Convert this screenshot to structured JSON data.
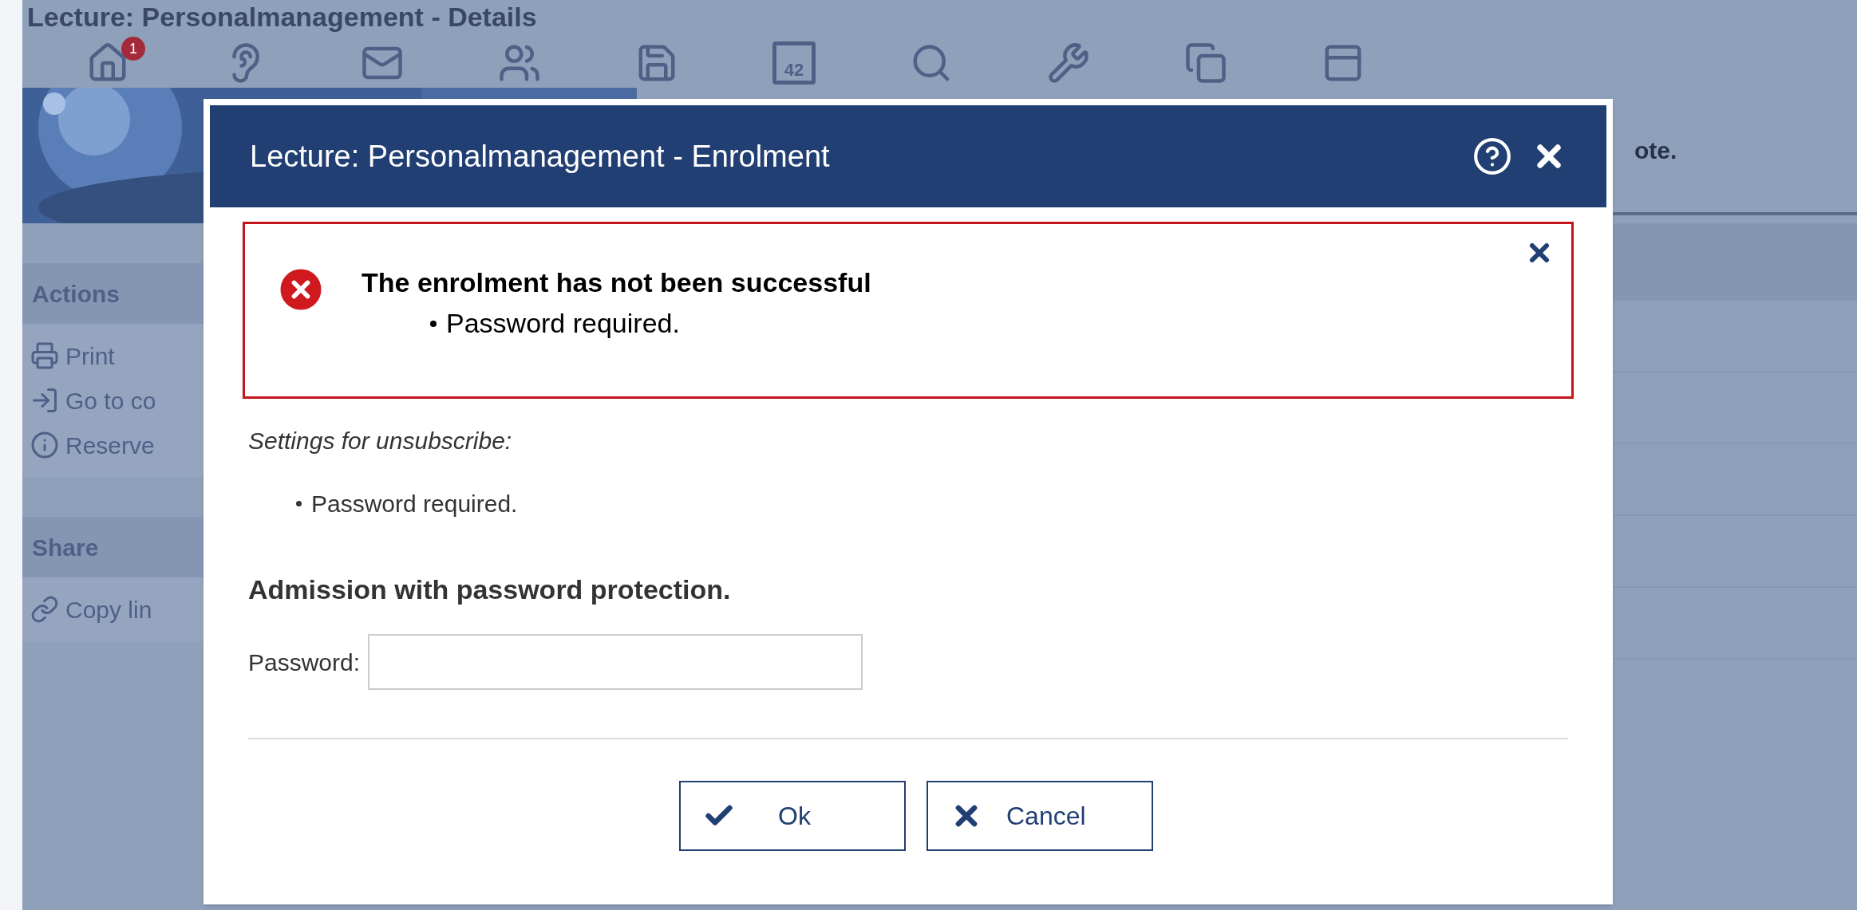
{
  "page": {
    "title": "Lecture: Personalmanagement - Details",
    "badge": "1",
    "calendar_day": "42",
    "side_note": "ote.",
    "sidebar": [
      {
        "title": "Actions",
        "items": [
          "Print",
          "Go to co",
          "Reserve"
        ]
      },
      {
        "title": "Share",
        "items": [
          "Copy lin"
        ]
      }
    ]
  },
  "dialog": {
    "title": "Lecture: Personalmanagement - Enrolment",
    "error": {
      "title": "The enrolment has not been successful",
      "items": [
        "Password required."
      ]
    },
    "settings_label": "Settings for unsubscribe:",
    "settings_items": [
      "Password required."
    ],
    "heading": "Admission with password protection.",
    "password": {
      "label": "Password:"
    },
    "buttons": [
      {
        "label": "Ok",
        "kind": "ok"
      },
      {
        "label": "Cancel",
        "kind": "cancel"
      }
    ]
  }
}
